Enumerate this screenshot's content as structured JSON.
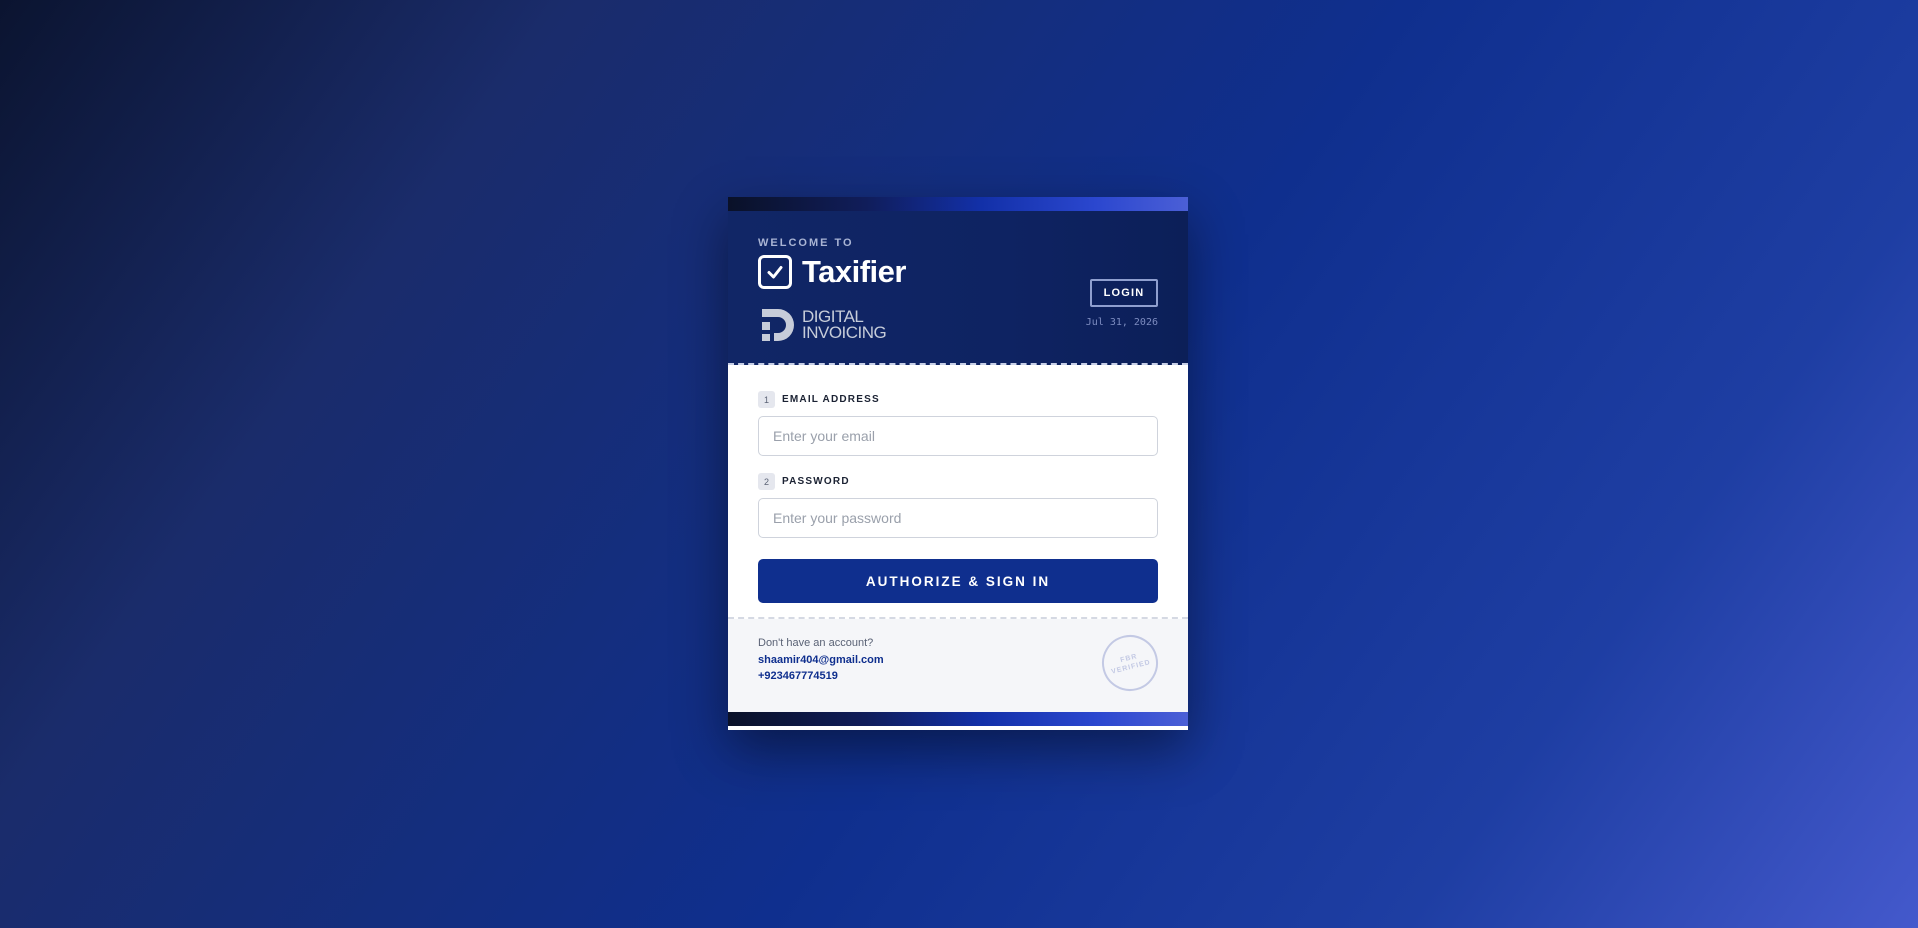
{
  "header": {
    "welcome": "WELCOME TO",
    "brand": "Taxifier",
    "di_line1": "DIGITAL",
    "di_line2": "INVOICING",
    "login_label": "LOGIN",
    "date": "Jul 31, 2026"
  },
  "form": {
    "email": {
      "step": "1",
      "label": "EMAIL ADDRESS",
      "placeholder": "Enter your email",
      "value": ""
    },
    "password": {
      "step": "2",
      "label": "PASSWORD",
      "placeholder": "Enter your password",
      "value": ""
    },
    "submit_label": "AUTHORIZE & SIGN IN"
  },
  "footer": {
    "question": "Don't have an account?",
    "email": "shaamir404@gmail.com",
    "phone": "+923467774519",
    "stamp_line1": "FBR",
    "stamp_line2": "VERIFIED"
  },
  "colors": {
    "primary": "#0f2f8e",
    "header_bg": "#112666",
    "accent": "#4b5fd6"
  },
  "icons": [
    "check-square-icon",
    "digital-invoicing-logo"
  ]
}
